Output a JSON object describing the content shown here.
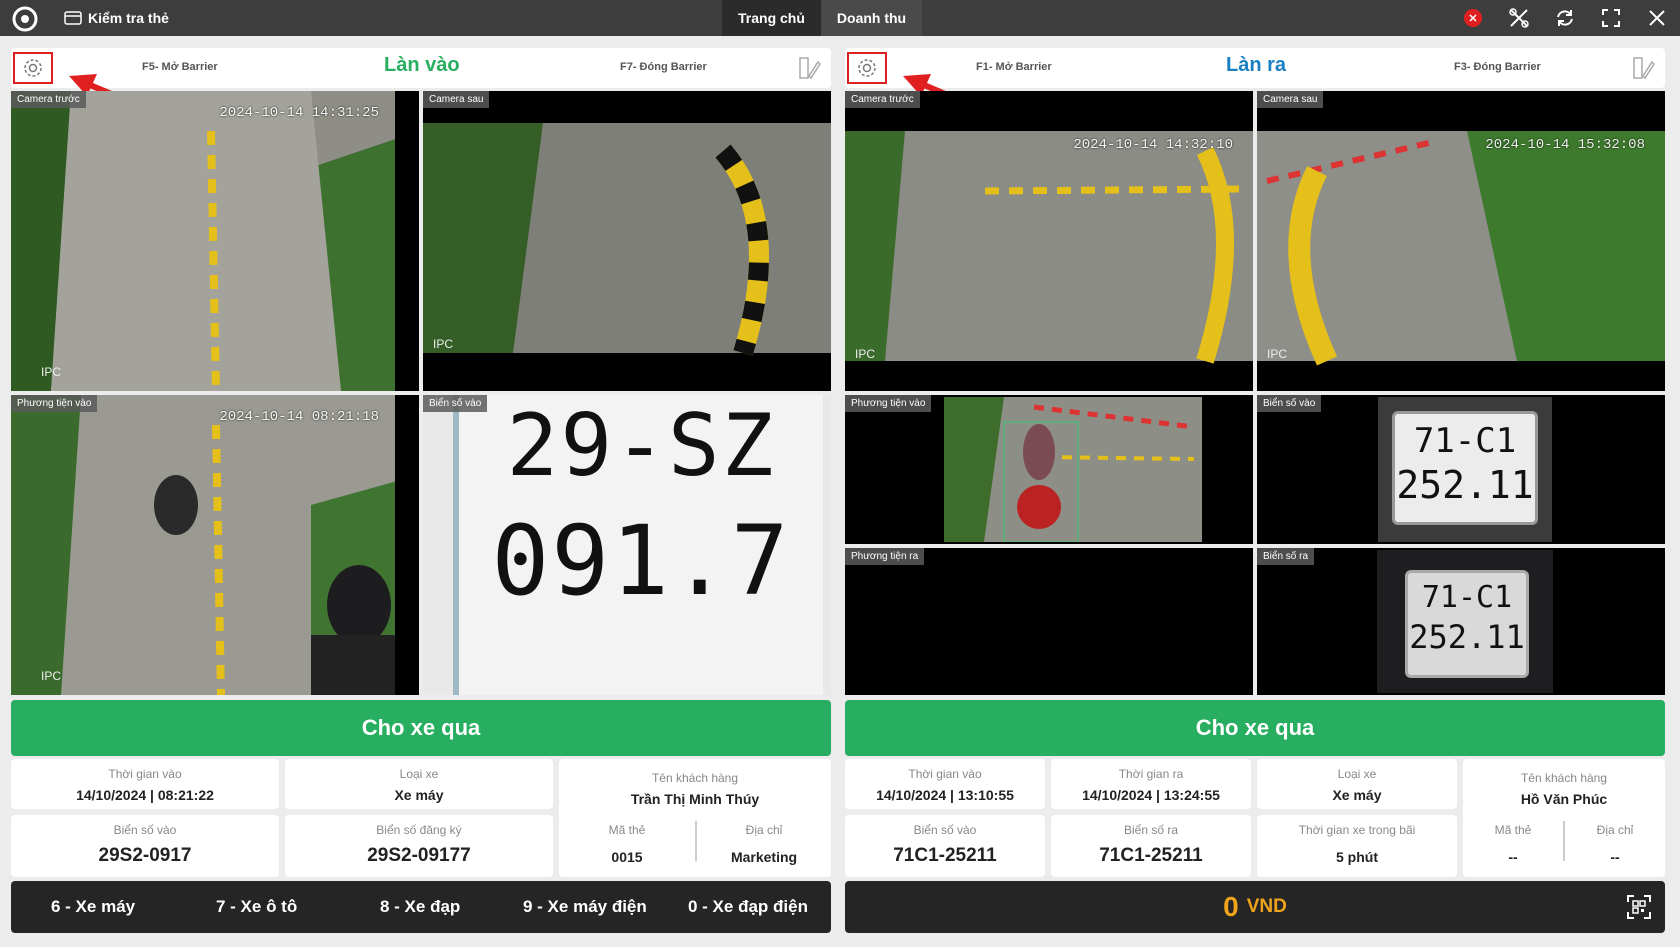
{
  "app": {
    "title": "Kiểm tra thẻ"
  },
  "nav": {
    "home": "Trang chủ",
    "revenue": "Doanh thu"
  },
  "left": {
    "lane_title": "Làn vào",
    "open_barrier": "F5- Mở Barrier",
    "close_barrier": "F7- Đóng Barrier",
    "cams": {
      "front": {
        "label": "Camera trước",
        "ts": "2024-10-14 14:31:25",
        "ipc": "IPC"
      },
      "rear": {
        "label": "Camera sau",
        "ipc": "IPC"
      },
      "vehicle_in": {
        "label": "Phương tiện vào",
        "ts": "2024-10-14 08:21:18",
        "ipc": "IPC"
      },
      "plate_in": {
        "label": "Biển số vào",
        "line1": "29-SZ",
        "line2": "091.7"
      }
    },
    "action": "Cho xe qua",
    "info": {
      "time_in_label": "Thời gian vào",
      "time_in": "14/10/2024 | 08:21:22",
      "vehicle_type_label": "Loại xe",
      "vehicle_type": "Xe máy",
      "customer_label": "Tên khách hàng",
      "customer": "Trần Thị Minh Thúy",
      "plate_in_label": "Biển số vào",
      "plate_in": "29S2-0917",
      "plate_reg_label": "Biển số đăng ký",
      "plate_reg": "29S2-09177",
      "card_label": "Mã thẻ",
      "card": "0015",
      "address_label": "Địa chỉ",
      "address": "Marketing"
    },
    "vehicle_types": [
      "6 - Xe máy",
      "7 - Xe ô tô",
      "8 - Xe đạp",
      "9 - Xe máy điện",
      "0 - Xe đạp điện"
    ]
  },
  "right": {
    "lane_title": "Làn ra",
    "open_barrier": "F1- Mở Barrier",
    "close_barrier": "F3- Đóng Barrier",
    "cams": {
      "front": {
        "label": "Camera trước",
        "ts": "2024-10-14 14:32:10",
        "ipc": "IPC"
      },
      "rear": {
        "label": "Camera sau",
        "ts": "2024-10-14 15:32:08",
        "ipc": "IPC"
      },
      "vehicle_in": {
        "label": "Phương tiện vào"
      },
      "plate_in": {
        "label": "Biển số vào",
        "line1": "71-C1",
        "line2": "252.11"
      },
      "vehicle_out": {
        "label": "Phương tiện ra"
      },
      "plate_out": {
        "label": "Biển số ra",
        "line1": "71-C1",
        "line2": "252.11"
      }
    },
    "action": "Cho xe qua",
    "info": {
      "time_in_label": "Thời gian vào",
      "time_in": "14/10/2024 | 13:10:55",
      "time_out_label": "Thời gian ra",
      "time_out": "14/10/2024 | 13:24:55",
      "vehicle_type_label": "Loại xe",
      "vehicle_type": "Xe máy",
      "customer_label": "Tên khách hàng",
      "customer": "Hồ Văn Phúc",
      "plate_in_label": "Biển số vào",
      "plate_in": "71C1-25211",
      "plate_out_label": "Biển số ra",
      "plate_out": "71C1-25211",
      "duration_label": "Thời gian xe trong bãi",
      "duration": "5 phút",
      "card_label": "Mã thẻ",
      "card": "--",
      "address_label": "Địa chỉ",
      "address": "--"
    },
    "fee": {
      "amount": "0",
      "currency": "VND"
    }
  },
  "colors": {
    "accent_green": "#27ae60",
    "lane_blue": "#1a7fc2",
    "alert_red": "#e02020",
    "fee_orange": "#f0a41c"
  }
}
